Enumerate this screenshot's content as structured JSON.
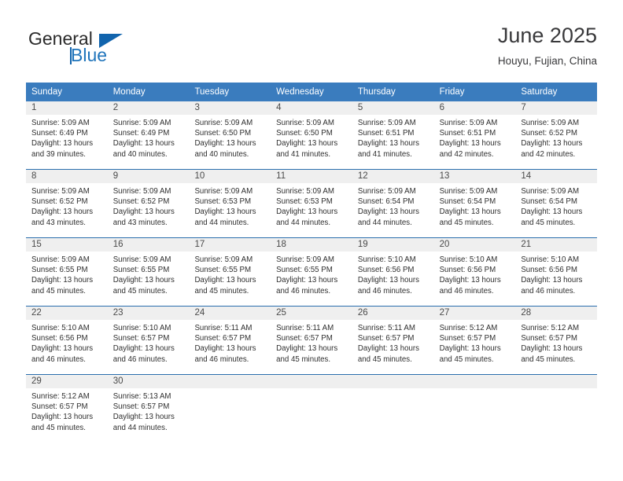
{
  "brand": {
    "name_top": "General",
    "name_bottom": "Blue"
  },
  "header": {
    "title": "June 2025",
    "subtitle": "Houyu, Fujian, China"
  },
  "colors": {
    "header_blue": "#3a7cbe",
    "row_divider_blue": "#2a6ead",
    "daynum_band": "#efefef",
    "brand_blue": "#1164ad",
    "text": "#2f2f2f"
  },
  "weekdays": [
    "Sunday",
    "Monday",
    "Tuesday",
    "Wednesday",
    "Thursday",
    "Friday",
    "Saturday"
  ],
  "weeks": [
    {
      "days": [
        {
          "num": "1",
          "sunrise": "Sunrise: 5:09 AM",
          "sunset": "Sunset: 6:49 PM",
          "daylight1": "Daylight: 13 hours",
          "daylight2": "and 39 minutes."
        },
        {
          "num": "2",
          "sunrise": "Sunrise: 5:09 AM",
          "sunset": "Sunset: 6:49 PM",
          "daylight1": "Daylight: 13 hours",
          "daylight2": "and 40 minutes."
        },
        {
          "num": "3",
          "sunrise": "Sunrise: 5:09 AM",
          "sunset": "Sunset: 6:50 PM",
          "daylight1": "Daylight: 13 hours",
          "daylight2": "and 40 minutes."
        },
        {
          "num": "4",
          "sunrise": "Sunrise: 5:09 AM",
          "sunset": "Sunset: 6:50 PM",
          "daylight1": "Daylight: 13 hours",
          "daylight2": "and 41 minutes."
        },
        {
          "num": "5",
          "sunrise": "Sunrise: 5:09 AM",
          "sunset": "Sunset: 6:51 PM",
          "daylight1": "Daylight: 13 hours",
          "daylight2": "and 41 minutes."
        },
        {
          "num": "6",
          "sunrise": "Sunrise: 5:09 AM",
          "sunset": "Sunset: 6:51 PM",
          "daylight1": "Daylight: 13 hours",
          "daylight2": "and 42 minutes."
        },
        {
          "num": "7",
          "sunrise": "Sunrise: 5:09 AM",
          "sunset": "Sunset: 6:52 PM",
          "daylight1": "Daylight: 13 hours",
          "daylight2": "and 42 minutes."
        }
      ]
    },
    {
      "days": [
        {
          "num": "8",
          "sunrise": "Sunrise: 5:09 AM",
          "sunset": "Sunset: 6:52 PM",
          "daylight1": "Daylight: 13 hours",
          "daylight2": "and 43 minutes."
        },
        {
          "num": "9",
          "sunrise": "Sunrise: 5:09 AM",
          "sunset": "Sunset: 6:52 PM",
          "daylight1": "Daylight: 13 hours",
          "daylight2": "and 43 minutes."
        },
        {
          "num": "10",
          "sunrise": "Sunrise: 5:09 AM",
          "sunset": "Sunset: 6:53 PM",
          "daylight1": "Daylight: 13 hours",
          "daylight2": "and 44 minutes."
        },
        {
          "num": "11",
          "sunrise": "Sunrise: 5:09 AM",
          "sunset": "Sunset: 6:53 PM",
          "daylight1": "Daylight: 13 hours",
          "daylight2": "and 44 minutes."
        },
        {
          "num": "12",
          "sunrise": "Sunrise: 5:09 AM",
          "sunset": "Sunset: 6:54 PM",
          "daylight1": "Daylight: 13 hours",
          "daylight2": "and 44 minutes."
        },
        {
          "num": "13",
          "sunrise": "Sunrise: 5:09 AM",
          "sunset": "Sunset: 6:54 PM",
          "daylight1": "Daylight: 13 hours",
          "daylight2": "and 45 minutes."
        },
        {
          "num": "14",
          "sunrise": "Sunrise: 5:09 AM",
          "sunset": "Sunset: 6:54 PM",
          "daylight1": "Daylight: 13 hours",
          "daylight2": "and 45 minutes."
        }
      ]
    },
    {
      "days": [
        {
          "num": "15",
          "sunrise": "Sunrise: 5:09 AM",
          "sunset": "Sunset: 6:55 PM",
          "daylight1": "Daylight: 13 hours",
          "daylight2": "and 45 minutes."
        },
        {
          "num": "16",
          "sunrise": "Sunrise: 5:09 AM",
          "sunset": "Sunset: 6:55 PM",
          "daylight1": "Daylight: 13 hours",
          "daylight2": "and 45 minutes."
        },
        {
          "num": "17",
          "sunrise": "Sunrise: 5:09 AM",
          "sunset": "Sunset: 6:55 PM",
          "daylight1": "Daylight: 13 hours",
          "daylight2": "and 45 minutes."
        },
        {
          "num": "18",
          "sunrise": "Sunrise: 5:09 AM",
          "sunset": "Sunset: 6:55 PM",
          "daylight1": "Daylight: 13 hours",
          "daylight2": "and 46 minutes."
        },
        {
          "num": "19",
          "sunrise": "Sunrise: 5:10 AM",
          "sunset": "Sunset: 6:56 PM",
          "daylight1": "Daylight: 13 hours",
          "daylight2": "and 46 minutes."
        },
        {
          "num": "20",
          "sunrise": "Sunrise: 5:10 AM",
          "sunset": "Sunset: 6:56 PM",
          "daylight1": "Daylight: 13 hours",
          "daylight2": "and 46 minutes."
        },
        {
          "num": "21",
          "sunrise": "Sunrise: 5:10 AM",
          "sunset": "Sunset: 6:56 PM",
          "daylight1": "Daylight: 13 hours",
          "daylight2": "and 46 minutes."
        }
      ]
    },
    {
      "days": [
        {
          "num": "22",
          "sunrise": "Sunrise: 5:10 AM",
          "sunset": "Sunset: 6:56 PM",
          "daylight1": "Daylight: 13 hours",
          "daylight2": "and 46 minutes."
        },
        {
          "num": "23",
          "sunrise": "Sunrise: 5:10 AM",
          "sunset": "Sunset: 6:57 PM",
          "daylight1": "Daylight: 13 hours",
          "daylight2": "and 46 minutes."
        },
        {
          "num": "24",
          "sunrise": "Sunrise: 5:11 AM",
          "sunset": "Sunset: 6:57 PM",
          "daylight1": "Daylight: 13 hours",
          "daylight2": "and 46 minutes."
        },
        {
          "num": "25",
          "sunrise": "Sunrise: 5:11 AM",
          "sunset": "Sunset: 6:57 PM",
          "daylight1": "Daylight: 13 hours",
          "daylight2": "and 45 minutes."
        },
        {
          "num": "26",
          "sunrise": "Sunrise: 5:11 AM",
          "sunset": "Sunset: 6:57 PM",
          "daylight1": "Daylight: 13 hours",
          "daylight2": "and 45 minutes."
        },
        {
          "num": "27",
          "sunrise": "Sunrise: 5:12 AM",
          "sunset": "Sunset: 6:57 PM",
          "daylight1": "Daylight: 13 hours",
          "daylight2": "and 45 minutes."
        },
        {
          "num": "28",
          "sunrise": "Sunrise: 5:12 AM",
          "sunset": "Sunset: 6:57 PM",
          "daylight1": "Daylight: 13 hours",
          "daylight2": "and 45 minutes."
        }
      ]
    },
    {
      "days": [
        {
          "num": "29",
          "sunrise": "Sunrise: 5:12 AM",
          "sunset": "Sunset: 6:57 PM",
          "daylight1": "Daylight: 13 hours",
          "daylight2": "and 45 minutes."
        },
        {
          "num": "30",
          "sunrise": "Sunrise: 5:13 AM",
          "sunset": "Sunset: 6:57 PM",
          "daylight1": "Daylight: 13 hours",
          "daylight2": "and 44 minutes."
        },
        {
          "num": "",
          "sunrise": "",
          "sunset": "",
          "daylight1": "",
          "daylight2": ""
        },
        {
          "num": "",
          "sunrise": "",
          "sunset": "",
          "daylight1": "",
          "daylight2": ""
        },
        {
          "num": "",
          "sunrise": "",
          "sunset": "",
          "daylight1": "",
          "daylight2": ""
        },
        {
          "num": "",
          "sunrise": "",
          "sunset": "",
          "daylight1": "",
          "daylight2": ""
        },
        {
          "num": "",
          "sunrise": "",
          "sunset": "",
          "daylight1": "",
          "daylight2": ""
        }
      ]
    }
  ]
}
